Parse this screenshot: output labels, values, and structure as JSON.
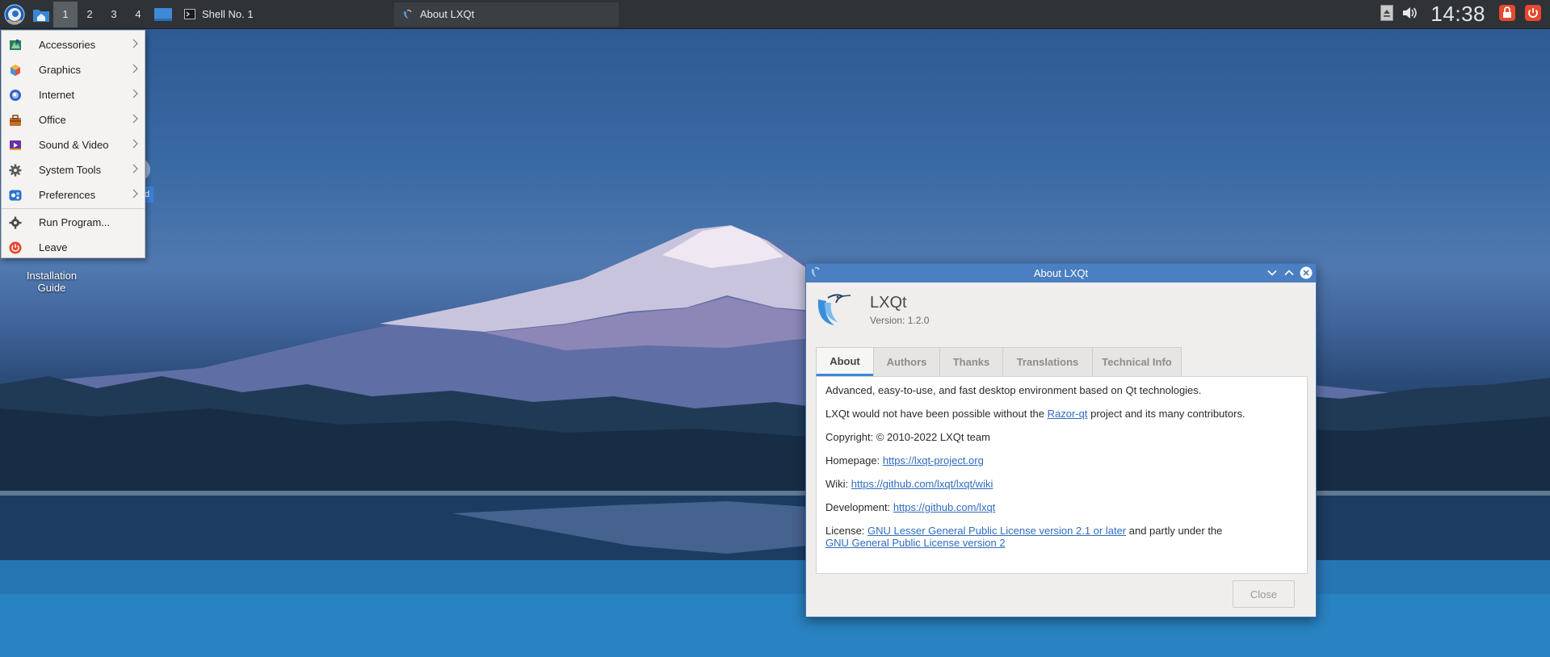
{
  "panel": {
    "desktops": [
      "1",
      "2",
      "3",
      "4"
    ],
    "active_desktop": "1",
    "tasks": [
      {
        "label": "Shell No. 1"
      },
      {
        "label": "About LXQt"
      }
    ],
    "clock": "14:38"
  },
  "app_menu": {
    "items": [
      {
        "label": "Accessories",
        "icon": "accessories-icon",
        "submenu": true
      },
      {
        "label": "Graphics",
        "icon": "graphics-icon",
        "submenu": true
      },
      {
        "label": "Internet",
        "icon": "internet-icon",
        "submenu": true
      },
      {
        "label": "Office",
        "icon": "office-icon",
        "submenu": true
      },
      {
        "label": "Sound & Video",
        "icon": "sound-video-icon",
        "submenu": true
      },
      {
        "label": "System Tools",
        "icon": "system-tools-icon",
        "submenu": true
      },
      {
        "label": "Preferences",
        "icon": "preferences-icon",
        "submenu": true
      }
    ],
    "actions": [
      {
        "label": "Run Program...",
        "icon": "run-program-icon"
      },
      {
        "label": "Leave",
        "icon": "leave-icon"
      }
    ]
  },
  "desktop": {
    "icon_label": "Installation Guide",
    "selection_fragment": "d"
  },
  "dialog": {
    "title": "About LXQt",
    "app_name": "LXQt",
    "version": "Version: 1.2.0",
    "tabs": [
      "About",
      "Authors",
      "Thanks",
      "Translations",
      "Technical Info"
    ],
    "active_tab": "About",
    "about": {
      "description": "Advanced, easy-to-use, and fast desktop environment based on Qt technologies.",
      "thanks_prefix": "LXQt would not have been possible without the ",
      "thanks_link": "Razor-qt",
      "thanks_suffix": " project and its many contributors.",
      "copyright": "Copyright: © 2010-2022 LXQt team",
      "homepage_label": "Homepage: ",
      "homepage_link": "https://lxqt-project.org",
      "wiki_label": "Wiki: ",
      "wiki_link": "https://github.com/lxqt/lxqt/wiki",
      "development_label": "Development: ",
      "development_link": "https://github.com/lxqt",
      "license_label": "License: ",
      "license_link1": "GNU Lesser General Public License version 2.1 or later",
      "license_middle": " and partly under the",
      "license_link2": "GNU General Public License version 2"
    },
    "close_label": "Close"
  },
  "colors": {
    "panel": "#2f3337",
    "titlebar": "#4a7fc1",
    "link": "#2f6cbd",
    "active_tab_underline": "#3d87d6"
  }
}
